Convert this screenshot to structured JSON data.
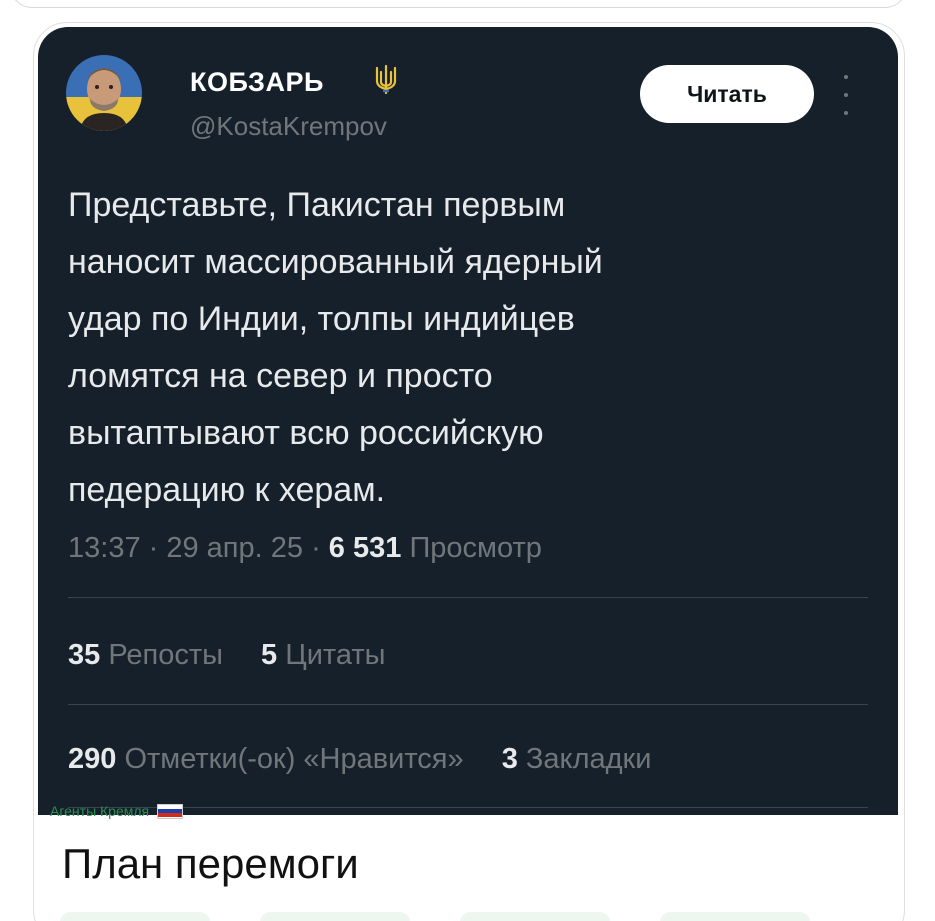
{
  "tweet": {
    "author_name": "КОБЗАРЬ",
    "author_handle": "@KostaKrempov",
    "follow_label": "Читать",
    "text": "Представьте, Пакистан первым\nнаносит массированный ядерный\nудар по Индии, толпы индийцев\nломятся на север и просто\nвытаптывают всю российскую\nпедерацию к херам.",
    "time": "13:37",
    "date": "29 апр. 25",
    "views_count": "6 531",
    "views_label": "Просмотр",
    "reposts_count": "35",
    "reposts_label": "Репосты",
    "quotes_count": "5",
    "quotes_label": "Цитаты",
    "likes_count": "290",
    "likes_label": "Отметки(-ок) «Нравится»",
    "bookmarks_count": "3",
    "bookmarks_label": "Закладки"
  },
  "watermark": {
    "text": "Агенты Кремля",
    "icon": "russia-flag-icon"
  },
  "message": {
    "caption": "План перемоги"
  },
  "colors": {
    "tweet_bg": "#15202b",
    "text_primary": "#e7e9ea",
    "text_secondary": "#71767b",
    "divider": "#38444d",
    "follow_bg": "#ffffff",
    "watermark": "#2d8f52"
  },
  "icons": {
    "verified": "trident-icon",
    "menu": "more-vertical-icon",
    "avatar": "avatar"
  }
}
